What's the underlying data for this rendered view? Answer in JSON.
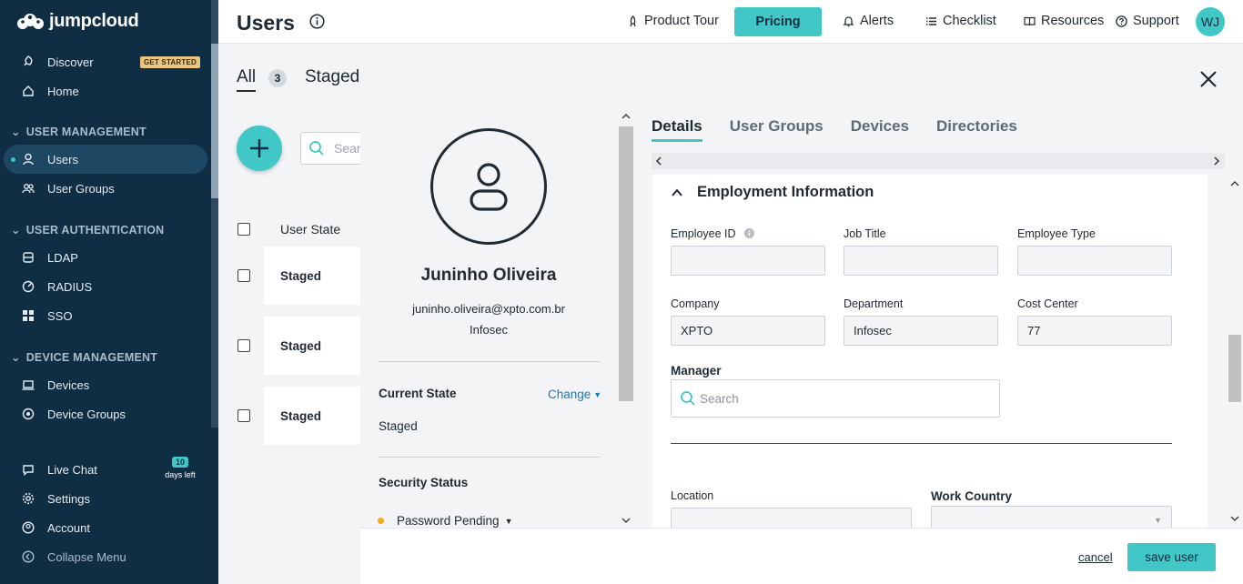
{
  "brand": {
    "name": "jumpcloud"
  },
  "colors": {
    "accent": "#41c8c6",
    "sidebar_bg": "#0f2e44",
    "link": "#1e79b3",
    "status_pending": "#f5a623"
  },
  "sidebar": {
    "discover": {
      "label": "Discover",
      "badge": "GET STARTED",
      "icon": "rocket-icon"
    },
    "home": {
      "label": "Home",
      "icon": "home-icon"
    },
    "sections": [
      {
        "title": "USER MANAGEMENT"
      },
      {
        "title": "USER AUTHENTICATION"
      },
      {
        "title": "DEVICE MANAGEMENT"
      }
    ],
    "users": {
      "label": "Users",
      "icon": "user-icon"
    },
    "user_groups": {
      "label": "User Groups",
      "icon": "users-icon"
    },
    "ldap": {
      "label": "LDAP",
      "icon": "database-icon"
    },
    "radius": {
      "label": "RADIUS",
      "icon": "radius-icon"
    },
    "sso": {
      "label": "SSO",
      "icon": "grid-icon"
    },
    "devices": {
      "label": "Devices",
      "icon": "laptop-icon"
    },
    "device_groups": {
      "label": "Device Groups",
      "icon": "device-groups-icon"
    },
    "live_chat": {
      "label": "Live Chat",
      "icon": "chat-icon"
    },
    "trial": {
      "days": "10",
      "text": "days left"
    },
    "settings": {
      "label": "Settings",
      "icon": "gear-icon"
    },
    "account": {
      "label": "Account",
      "icon": "account-icon"
    },
    "collapse": {
      "label": "Collapse Menu",
      "icon": "collapse-icon"
    }
  },
  "header": {
    "title": "Users",
    "product_tour": "Product Tour",
    "pricing": "Pricing",
    "alerts": "Alerts",
    "checklist": "Checklist",
    "resources": "Resources",
    "support": "Support",
    "avatar_initials": "WJ"
  },
  "list": {
    "tab_all": "All",
    "count": "3",
    "tab_staged": "Staged",
    "search_placeholder": "Sear",
    "column_user_state": "User State",
    "rows": [
      {
        "state": "Staged"
      },
      {
        "state": "Staged"
      },
      {
        "state": "Staged"
      }
    ]
  },
  "profile": {
    "name": "Juninho Oliveira",
    "email": "juninho.oliveira@xpto.com.br",
    "department": "Infosec",
    "current_state_label": "Current State",
    "change_label": "Change",
    "current_state_value": "Staged",
    "security_status_label": "Security Status",
    "password_status": "Password Pending"
  },
  "detail_tabs": [
    "Details",
    "User Groups",
    "Devices",
    "Directories"
  ],
  "employment": {
    "title": "Employment Information",
    "employee_id": {
      "label": "Employee ID",
      "value": ""
    },
    "job_title": {
      "label": "Job Title",
      "value": ""
    },
    "employee_type": {
      "label": "Employee Type",
      "value": ""
    },
    "company": {
      "label": "Company",
      "value": "XPTO"
    },
    "department": {
      "label": "Department",
      "value": "Infosec"
    },
    "cost_center": {
      "label": "Cost Center",
      "value": "77"
    },
    "manager": {
      "label": "Manager",
      "placeholder": "Search"
    },
    "location": {
      "label": "Location",
      "value": ""
    },
    "work_country": {
      "label": "Work Country",
      "value": ""
    }
  },
  "footer": {
    "cancel": "cancel",
    "save": "save user"
  }
}
